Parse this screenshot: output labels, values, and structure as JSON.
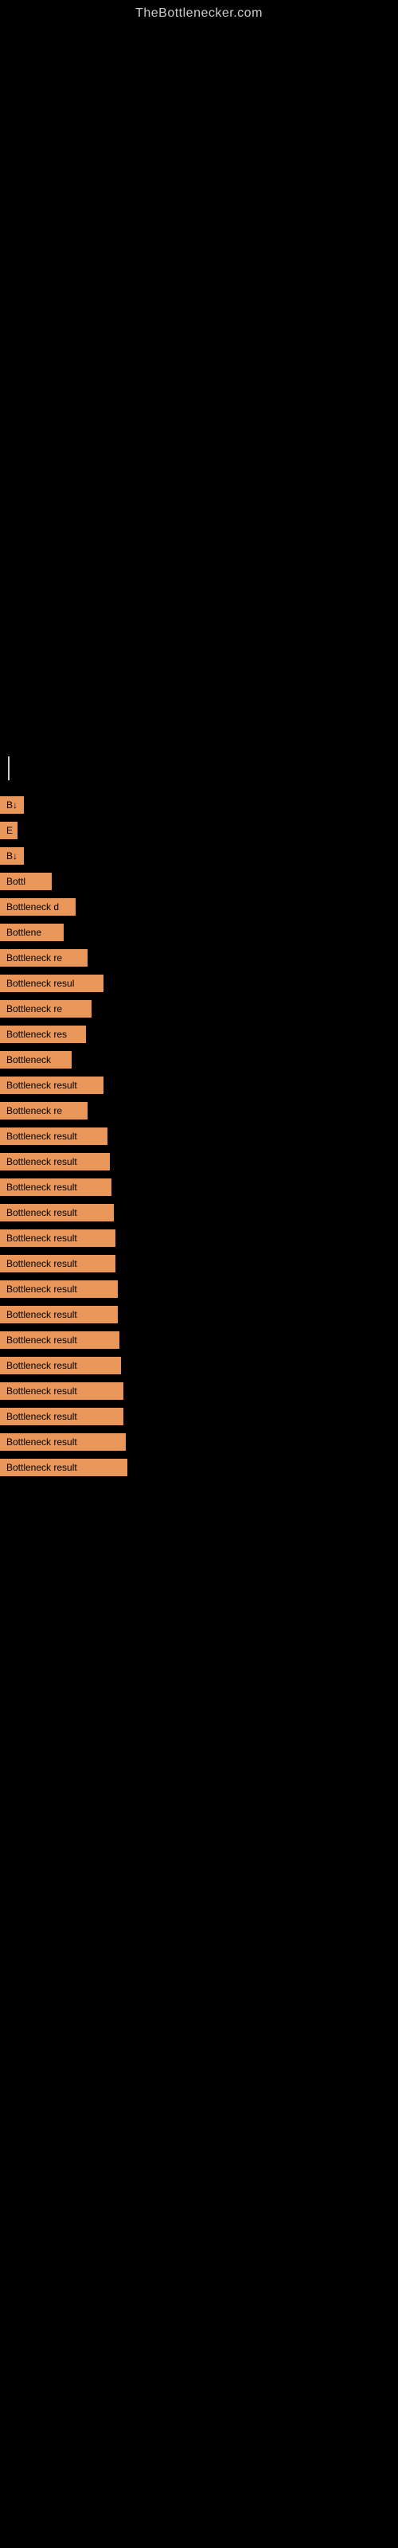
{
  "site": {
    "title": "TheBottlenecker.com"
  },
  "results": [
    {
      "id": 1,
      "label": "B↓"
    },
    {
      "id": 2,
      "label": "E"
    },
    {
      "id": 3,
      "label": "B↓"
    },
    {
      "id": 4,
      "label": "Bottl"
    },
    {
      "id": 5,
      "label": "Bottleneck d"
    },
    {
      "id": 6,
      "label": "Bottlene"
    },
    {
      "id": 7,
      "label": "Bottleneck re"
    },
    {
      "id": 8,
      "label": "Bottleneck resul"
    },
    {
      "id": 9,
      "label": "Bottleneck re"
    },
    {
      "id": 10,
      "label": "Bottleneck res"
    },
    {
      "id": 11,
      "label": "Bottleneck"
    },
    {
      "id": 12,
      "label": "Bottleneck result"
    },
    {
      "id": 13,
      "label": "Bottleneck re"
    },
    {
      "id": 14,
      "label": "Bottleneck result"
    },
    {
      "id": 15,
      "label": "Bottleneck result"
    },
    {
      "id": 16,
      "label": "Bottleneck result"
    },
    {
      "id": 17,
      "label": "Bottleneck result"
    },
    {
      "id": 18,
      "label": "Bottleneck result"
    },
    {
      "id": 19,
      "label": "Bottleneck result"
    },
    {
      "id": 20,
      "label": "Bottleneck result"
    },
    {
      "id": 21,
      "label": "Bottleneck result"
    },
    {
      "id": 22,
      "label": "Bottleneck result"
    },
    {
      "id": 23,
      "label": "Bottleneck result"
    },
    {
      "id": 24,
      "label": "Bottleneck result"
    },
    {
      "id": 25,
      "label": "Bottleneck result"
    },
    {
      "id": 26,
      "label": "Bottleneck result"
    },
    {
      "id": 27,
      "label": "Bottleneck result"
    }
  ]
}
